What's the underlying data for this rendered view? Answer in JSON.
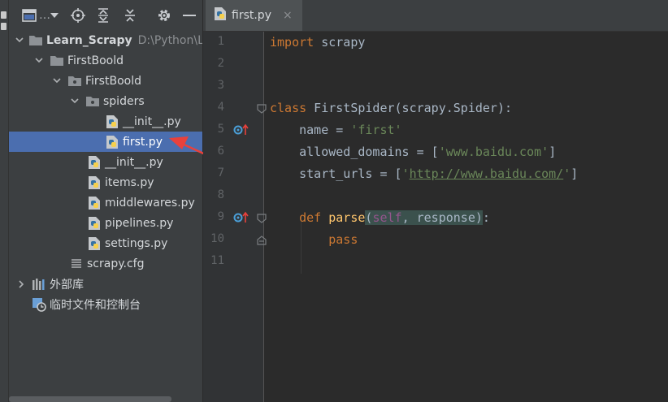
{
  "colors": {
    "selection": "#4b6eaf",
    "keyword": "#cc7832",
    "string": "#6a8759",
    "function": "#ffc66d",
    "self": "#94558d"
  },
  "project_panel": {
    "toolbar_icons": [
      "project-view-icon",
      "dropdown-icon",
      "locate-icon",
      "expand-all-icon",
      "collapse-all-icon",
      "settings-icon",
      "hide-icon"
    ],
    "tree": [
      {
        "label": "Learn_Scrapy",
        "path": "D:\\Python\\Le",
        "icon": "folder-icon",
        "depth": 0,
        "expanded": true
      },
      {
        "label": "FirstBoold",
        "icon": "folder-icon",
        "depth": 1,
        "expanded": true
      },
      {
        "label": "FirstBoold",
        "icon": "package-icon",
        "depth": 2,
        "expanded": true
      },
      {
        "label": "spiders",
        "icon": "package-icon",
        "depth": 3,
        "expanded": true
      },
      {
        "label": "__init__.py",
        "icon": "python-file-icon",
        "depth": 4
      },
      {
        "label": "first.py",
        "icon": "python-file-icon",
        "depth": 4,
        "selected": true
      },
      {
        "label": "__init__.py",
        "icon": "python-file-icon",
        "depth": 3
      },
      {
        "label": "items.py",
        "icon": "python-file-icon",
        "depth": 3
      },
      {
        "label": "middlewares.py",
        "icon": "python-file-icon",
        "depth": 3
      },
      {
        "label": "pipelines.py",
        "icon": "python-file-icon",
        "depth": 3
      },
      {
        "label": "settings.py",
        "icon": "python-file-icon",
        "depth": 3
      },
      {
        "label": "scrapy.cfg",
        "icon": "config-file-icon",
        "depth": 2
      },
      {
        "label": "外部库",
        "icon": "library-icon",
        "depth": 0,
        "expanded": false
      },
      {
        "label": "临时文件和控制台",
        "icon": "scratches-icon",
        "depth": 0
      }
    ]
  },
  "editor": {
    "tab": {
      "label": "first.py",
      "close": "×"
    },
    "line_numbers": [
      "1",
      "2",
      "3",
      "4",
      "5",
      "6",
      "7",
      "8",
      "9",
      "10",
      "11"
    ],
    "lines": {
      "l1": {
        "kw": "import",
        "rest": " scrapy"
      },
      "l4": {
        "kw": "class",
        "name": " FirstSpider",
        "rest": "(scrapy.Spider):"
      },
      "l5": {
        "rest": "    name = ",
        "str": "'first'"
      },
      "l6": {
        "rest": "    allowed_domains = [",
        "str": "'www.baidu.com'",
        "end": "]"
      },
      "l7": {
        "rest": "    start_urls = [",
        "q1": "'",
        "url": "http://www.baidu.com/",
        "q2": "'",
        "end": "]"
      },
      "l9": {
        "indent": "    ",
        "kw": "def",
        "fn": " parse",
        "lp": "(",
        "self": "self",
        "comma": ", response",
        "rp": ")",
        "end": ":"
      },
      "l10": {
        "indent": "        ",
        "kw": "pass"
      }
    }
  }
}
